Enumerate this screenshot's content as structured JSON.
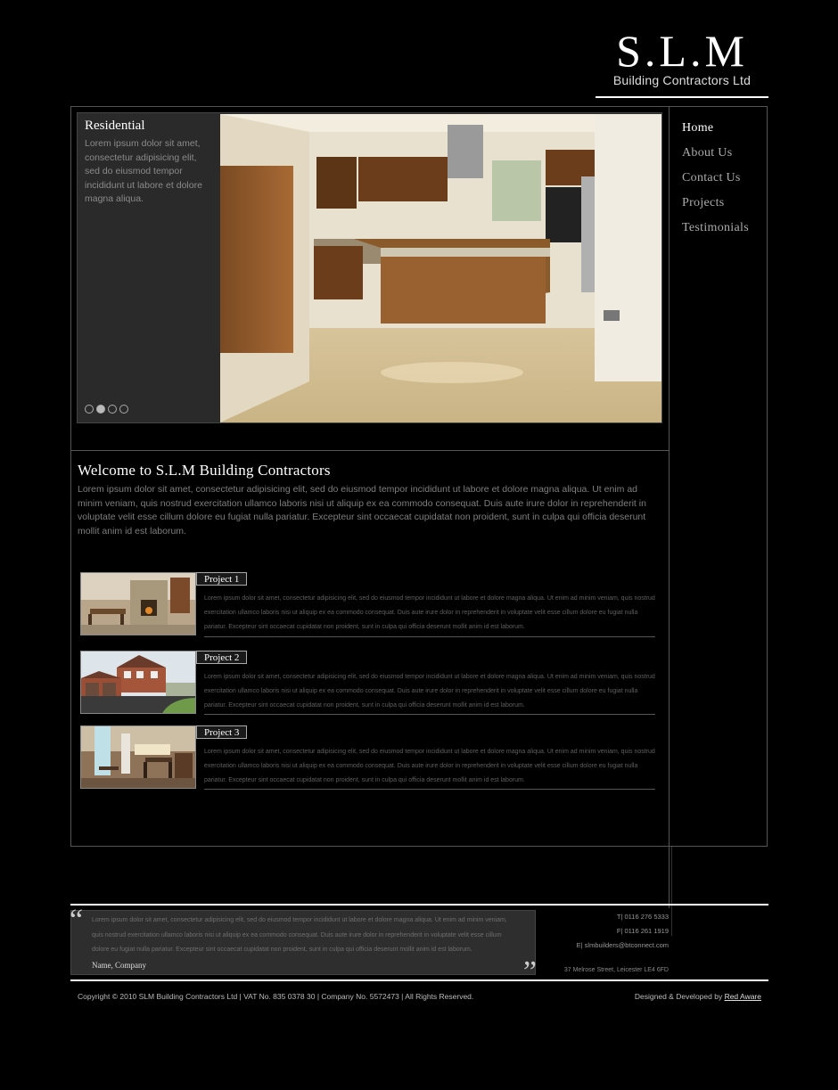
{
  "logo": {
    "main": "S.L.M",
    "sub": "Building Contractors Ltd"
  },
  "nav": [
    {
      "label": "Home"
    },
    {
      "label": "About Us"
    },
    {
      "label": "Contact Us"
    },
    {
      "label": "Projects"
    },
    {
      "label": "Testimonials"
    }
  ],
  "slider": {
    "title": "Residential",
    "text": "Lorem ipsum dolor sit amet, consectetur adipisicing elit, sed do eiusmod tempor incididunt ut labore et dolore magna aliqua.",
    "active_dot": 2
  },
  "welcome": {
    "title": "Welcome to S.L.M Building Contractors",
    "text": "Lorem ipsum dolor sit amet, consectetur adipisicing elit, sed do eiusmod tempor incididunt ut labore et dolore magna aliqua. Ut enim ad minim veniam, quis nostrud exercitation ullamco laboris nisi ut aliquip ex ea commodo consequat. Duis aute irure dolor in reprehenderit in voluptate velit esse cillum dolore eu fugiat nulla pariatur. Excepteur sint occaecat cupidatat non proident, sunt in culpa qui officia deserunt mollit anim id est laborum."
  },
  "projects": [
    {
      "title": "Project 1",
      "text": "Lorem ipsum dolor sit amet, consectetur adipisicing elit, sed do eiusmod tempor incididunt ut labore et dolore magna aliqua. Ut enim ad minim veniam, quis nostrud exercitation ullamco laboris nisi ut aliquip ex ea commodo consequat. Duis aute irure dolor in reprehenderit in voluptate velit esse cillum dolore eu fugiat nulla pariatur. Excepteur sint occaecat cupidatat non proident, sunt in culpa qui officia deserunt mollit anim id est laborum."
    },
    {
      "title": "Project 2",
      "text": "Lorem ipsum dolor sit amet, consectetur adipisicing elit, sed do eiusmod tempor incididunt ut labore et dolore magna aliqua. Ut enim ad minim veniam, quis nostrud exercitation ullamco laboris nisi ut aliquip ex ea commodo consequat. Duis aute irure dolor in reprehenderit in voluptate velit esse cillum dolore eu fugiat nulla pariatur. Excepteur sint occaecat cupidatat non proident, sunt in culpa qui officia deserunt mollit anim id est laborum."
    },
    {
      "title": "Project 3",
      "text": "Lorem ipsum dolor sit amet, consectetur adipisicing elit, sed do eiusmod tempor incididunt ut labore et dolore magna aliqua. Ut enim ad minim veniam, quis nostrud exercitation ullamco laboris nisi ut aliquip ex ea commodo consequat. Duis aute irure dolor in reprehenderit in voluptate velit esse cillum dolore eu fugiat nulla pariatur. Excepteur sint occaecat cupidatat non proident, sunt in culpa qui officia deserunt mollit anim id est laborum."
    }
  ],
  "testimonial": {
    "quote_open": "“",
    "quote_close": "”",
    "text": "Lorem ipsum dolor sit amet, consectetur adipisicing elit, sed do eiusmod tempor incididunt ut labore et dolore magna aliqua. Ut enim ad minim veniam, quis nostrud exercitation ullamco laboris nisi ut aliquip ex ea commodo consequat. Duis aute irure dolor in reprehenderit in voluptate velit esse cillum dolore eu fugiat nulla pariatur. Excepteur sint occaecat cupidatat non proident, sunt in culpa qui officia deserunt mollit anim id est laborum.",
    "name": "Name, Company"
  },
  "contact": {
    "tel": "T| 0116 276 5333",
    "fax": "F| 0116 261 1919",
    "email": "E| slmbuilders@btconnect.com",
    "address": "37 Melrose Street, Leicester LE4 6FD"
  },
  "footer": {
    "copyright": "Copyright © 2010 SLM Building Contractors Ltd | VAT No. 835 0378 30 | Company No. 5572473 | All Rights Reserved.",
    "credit_prefix": "Designed & Developed by ",
    "credit_link": "Red Aware"
  },
  "colors": {
    "background": "#000000",
    "panel": "#2e2e2e",
    "text_muted": "#7d7d7d",
    "border": "#555555"
  }
}
